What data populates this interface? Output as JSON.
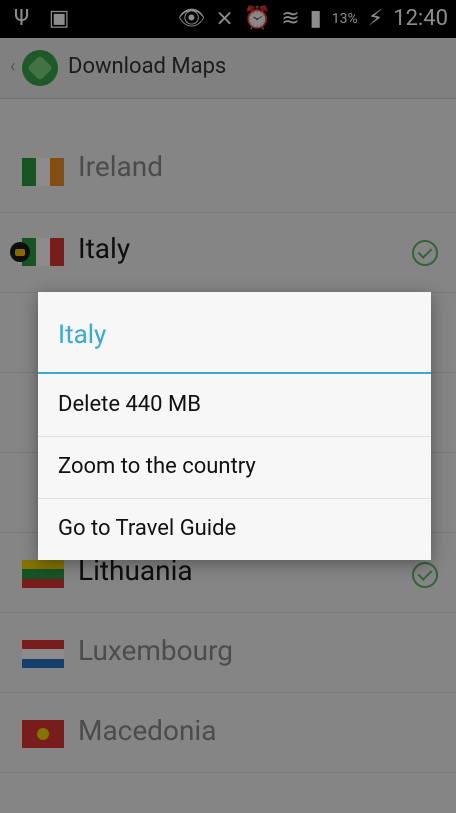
{
  "status_bar": {
    "time": "12:40",
    "battery_percent": "13%",
    "left_icons": [
      "usb-icon",
      "sim-icon"
    ],
    "right_icons": [
      "eye-icon",
      "signal-off-icon",
      "alarm-icon",
      "wifi-icon",
      "cellular-signal-icon",
      "battery-charging-icon"
    ]
  },
  "action_bar": {
    "title": "Download Maps"
  },
  "countries": [
    {
      "name": "Ireland",
      "downloaded": false
    },
    {
      "name": "Italy",
      "downloaded": true,
      "selected": true
    },
    {
      "name": "Lithuania",
      "downloaded": true
    },
    {
      "name": "Luxembourg",
      "downloaded": false
    },
    {
      "name": "Macedonia",
      "downloaded": false
    }
  ],
  "dialog": {
    "title": "Italy",
    "items": [
      {
        "label": "Delete 440 MB"
      },
      {
        "label": "Zoom to the country"
      },
      {
        "label": "Go to Travel Guide"
      }
    ]
  },
  "colors": {
    "accent": "#39a9d5",
    "check": "#61b56c"
  }
}
